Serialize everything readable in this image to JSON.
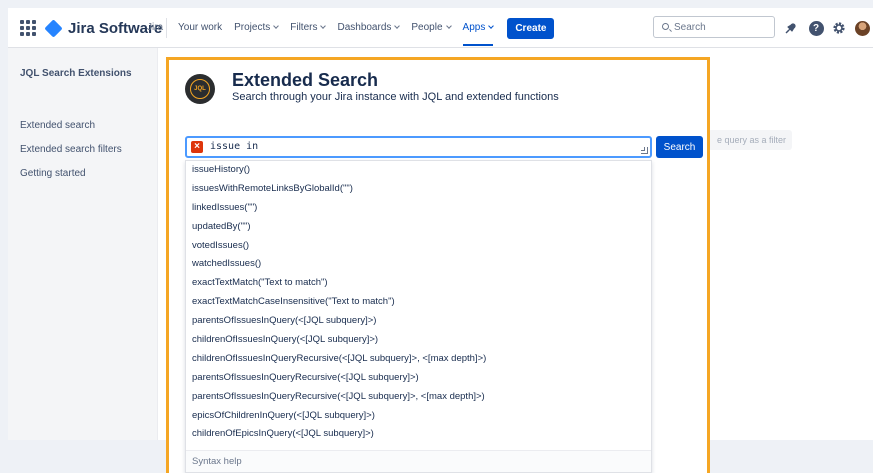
{
  "header": {
    "product_name": "Jira Software",
    "product_sub": "Jira",
    "nav": [
      {
        "label": "Your work"
      },
      {
        "label": "Projects"
      },
      {
        "label": "Filters"
      },
      {
        "label": "Dashboards"
      },
      {
        "label": "People"
      },
      {
        "label": "Apps"
      }
    ],
    "create_label": "Create",
    "search_placeholder": "Search"
  },
  "sidebar": {
    "title": "JQL Search Extensions",
    "items": [
      {
        "label": "Extended search"
      },
      {
        "label": "Extended search filters"
      },
      {
        "label": "Getting started"
      }
    ]
  },
  "main": {
    "save_filter_hint": "e query as a filter"
  },
  "extension": {
    "logo_text": "JQL",
    "title": "Extended Search",
    "subtitle": "Search through your Jira instance with JQL and extended functions",
    "query_value": "issue in",
    "search_button": "Search",
    "suggestions": [
      "issueHistory()",
      "issuesWithRemoteLinksByGlobalId(\"\")",
      "linkedIssues(\"\")",
      "updatedBy(\"\")",
      "votedIssues()",
      "watchedIssues()",
      "exactTextMatch(\"Text to match\")",
      "exactTextMatchCaseInsensitive(\"Text to match\")",
      "parentsOfIssuesInQuery(<[JQL subquery]>)",
      "childrenOfIssuesInQuery(<[JQL subquery]>)",
      "childrenOfIssuesInQueryRecursive(<[JQL subquery]>, <[max depth]>)",
      "parentsOfIssuesInQueryRecursive(<[JQL subquery]>)",
      "parentsOfIssuesInQueryRecursive(<[JQL subquery]>, <[max depth]>)",
      "epicsOfChildrenInQuery(<[JQL subquery]>)",
      "childrenOfEpicsInQuery(<[JQL subquery]>)"
    ],
    "syntax_help": "Syntax help"
  },
  "colors": {
    "primary": "#0052cc",
    "highlight_border": "#f5a623",
    "error": "#de350b"
  }
}
